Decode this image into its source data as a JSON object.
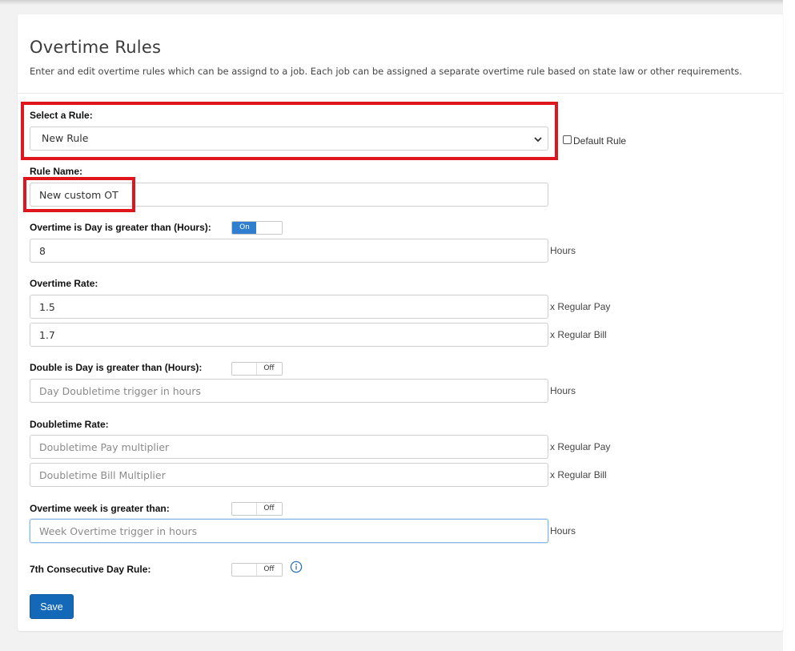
{
  "page": {
    "title": "Overtime Rules",
    "subtitle": "Enter and edit overtime rules which can be assignd to a job. Each job can be assigned a separate overtime rule based on state law or other requirements."
  },
  "select_rule": {
    "label": "Select a Rule:",
    "value": "New Rule",
    "default_label": "Default Rule",
    "default_checked": false
  },
  "rule_name": {
    "label": "Rule Name:",
    "value": "New custom OT"
  },
  "ot_day": {
    "label": "Overtime is Day is greater than (Hours):",
    "toggle": "On",
    "value": "8",
    "suffix": "Hours"
  },
  "ot_rate": {
    "label": "Overtime Rate:",
    "pay_value": "1.5",
    "pay_suffix": "x Regular Pay",
    "bill_value": "1.7",
    "bill_suffix": "x Regular Bill"
  },
  "double_day": {
    "label": "Double is Day is greater than (Hours):",
    "toggle": "Off",
    "placeholder": "Day Doubletime trigger in hours",
    "suffix": "Hours"
  },
  "double_rate": {
    "label": "Doubletime Rate:",
    "pay_placeholder": "Doubletime Pay multiplier",
    "pay_suffix": "x Regular Pay",
    "bill_placeholder": "Doubletime Bill Multiplier",
    "bill_suffix": "x Regular Bill"
  },
  "ot_week": {
    "label": "Overtime week is greater than:",
    "toggle": "Off",
    "placeholder": "Week Overtime trigger in hours",
    "suffix": "Hours"
  },
  "seventh_day": {
    "label": "7th Consecutive Day Rule:",
    "toggle": "Off"
  },
  "save_label": "Save",
  "colors": {
    "highlight": "#e0161f",
    "primary": "#1468b8",
    "toggle_on": "#2f7ed0"
  },
  "icons": {
    "select_chevron": "chevron-down-icon",
    "seventh_info": "info-icon"
  }
}
